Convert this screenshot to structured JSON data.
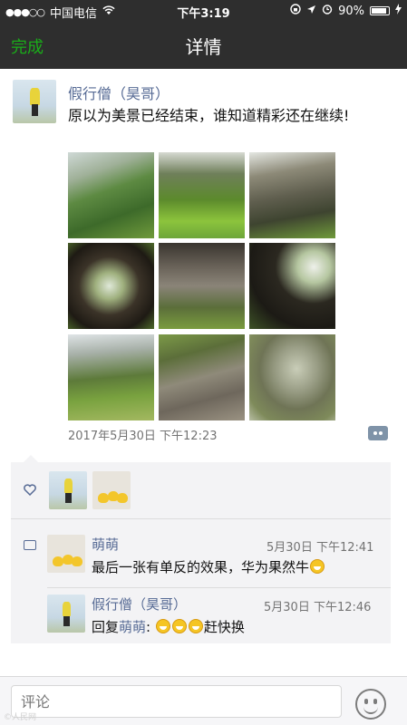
{
  "status_bar": {
    "signal": "●●●○○",
    "carrier": "中国电信",
    "time": "下午3:19",
    "battery": "90%"
  },
  "nav": {
    "done_label": "完成",
    "title": "详情"
  },
  "post": {
    "author": "假行僧（昊哥）",
    "text": "原以为美景已经结束，谁知道精彩还在继续!",
    "timestamp": "2017年5月30日 下午12:23",
    "photos": [
      {
        "scene": "valley-green"
      },
      {
        "scene": "canyon-meadow"
      },
      {
        "scene": "cliff-cave"
      },
      {
        "scene": "cave-arch-people"
      },
      {
        "scene": "rock-overhang-hiker"
      },
      {
        "scene": "cave-opening-green"
      },
      {
        "scene": "mountain-valley"
      },
      {
        "scene": "layered-rock-cliff"
      },
      {
        "scene": "blurry-rock"
      }
    ]
  },
  "likes": {
    "icon": "heart-outline-icon"
  },
  "comments": [
    {
      "name": "萌萌",
      "time": "5月30日 下午12:41",
      "text": "最后一张有单反的效果，华为果然牛"
    },
    {
      "name": "假行僧（昊哥）",
      "time": "5月30日 下午12:46",
      "reply_prefix": "回复",
      "reply_to": "萌萌",
      "colon": ":",
      "text": "赶快换"
    }
  ],
  "composer": {
    "placeholder": "评论"
  },
  "watermark": "©人民网"
}
